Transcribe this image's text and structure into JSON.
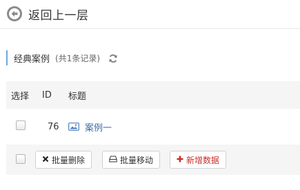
{
  "header": {
    "back_label": "返回上一层"
  },
  "section": {
    "title": "经典案例",
    "count_text": "(共1条记录)",
    "accent_color": "#6fa8dc"
  },
  "table": {
    "columns": [
      "选择",
      "ID",
      "标题"
    ],
    "rows": [
      {
        "id": "76",
        "title": "案例一",
        "icon": "image-icon"
      }
    ]
  },
  "actions": {
    "batch_delete": "批量删除",
    "batch_move": "批量移动",
    "add_data": "新增数据",
    "danger_color": "#c9302c"
  }
}
